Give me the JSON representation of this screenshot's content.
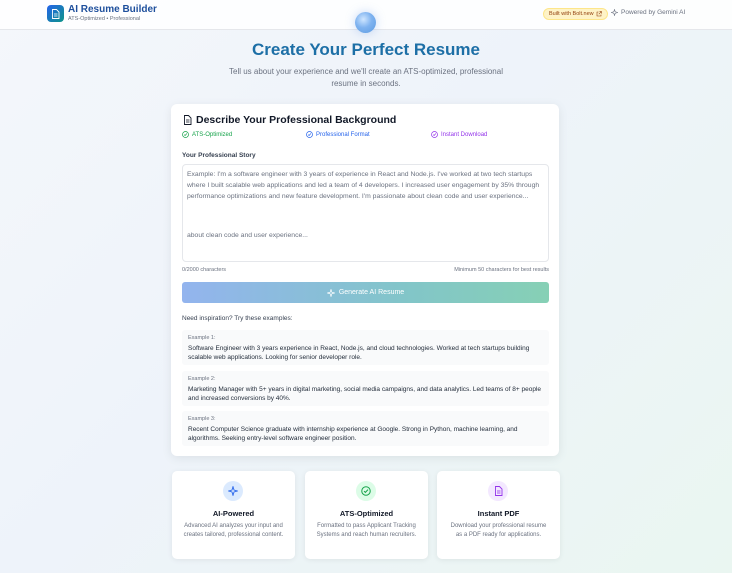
{
  "header": {
    "app_title": "AI Resume Builder",
    "app_subtitle": "ATS-Optimized • Professional",
    "bolt_badge": "Built with Bolt.new",
    "powered_by": "Powered by Gemini AI"
  },
  "hero": {
    "title": "Create Your Perfect Resume",
    "subtitle": "Tell us about your experience and we'll create an ATS-optimized, professional resume in seconds."
  },
  "form": {
    "title": "Describe Your Professional Background",
    "features": [
      {
        "label": "ATS-Optimized",
        "color": "#16a34a",
        "icon": "check-circle-icon"
      },
      {
        "label": "Professional Format",
        "color": "#2563eb",
        "icon": "check-circle-icon"
      },
      {
        "label": "Instant Download",
        "color": "#9333ea",
        "icon": "check-circle-icon"
      }
    ],
    "story_label": "Your Professional Story",
    "story_placeholder": "Example: I'm a software engineer with 3 years of experience in React and Node.js. I've worked at two tech startups where I built scalable web applications and led a team of 4 developers. I increased user engagement by 35% through performance optimizations and new feature development. I'm passionate about clean code and user experience...",
    "story_overlap": "about clean code and user experience...",
    "char_count": "0/2000 characters",
    "char_min": "Minimum 50 characters for best results",
    "generate_label": "Generate AI Resume",
    "inspiration_label": "Need inspiration? Try these examples:",
    "examples": [
      {
        "num": "Example 1:",
        "text": "Software Engineer with 3 years experience in React, Node.js, and cloud technologies. Worked at tech startups building scalable web applications. Looking for senior developer role."
      },
      {
        "num": "Example 2:",
        "text": "Marketing Manager with 5+ years in digital marketing, social media campaigns, and data analytics. Led teams of 8+ people and increased conversions by 40%."
      },
      {
        "num": "Example 3:",
        "text": "Recent Computer Science graduate with internship experience at Google. Strong in Python, machine learning, and algorithms. Seeking entry-level software engineer position."
      }
    ]
  },
  "feature_cards": [
    {
      "title": "AI-Powered",
      "desc": "Advanced AI analyzes your input and creates tailored, professional content.",
      "icon": "sparkles-icon",
      "color": "#2563eb",
      "bg": "#dbeafe"
    },
    {
      "title": "ATS-Optimized",
      "desc": "Formatted to pass Applicant Tracking Systems and reach human recruiters.",
      "icon": "check-circle-icon",
      "color": "#16a34a",
      "bg": "#dcfce7"
    },
    {
      "title": "Instant PDF",
      "desc": "Download your professional resume as a PDF ready for applications.",
      "icon": "document-icon",
      "color": "#9333ea",
      "bg": "#f3e8ff"
    }
  ]
}
